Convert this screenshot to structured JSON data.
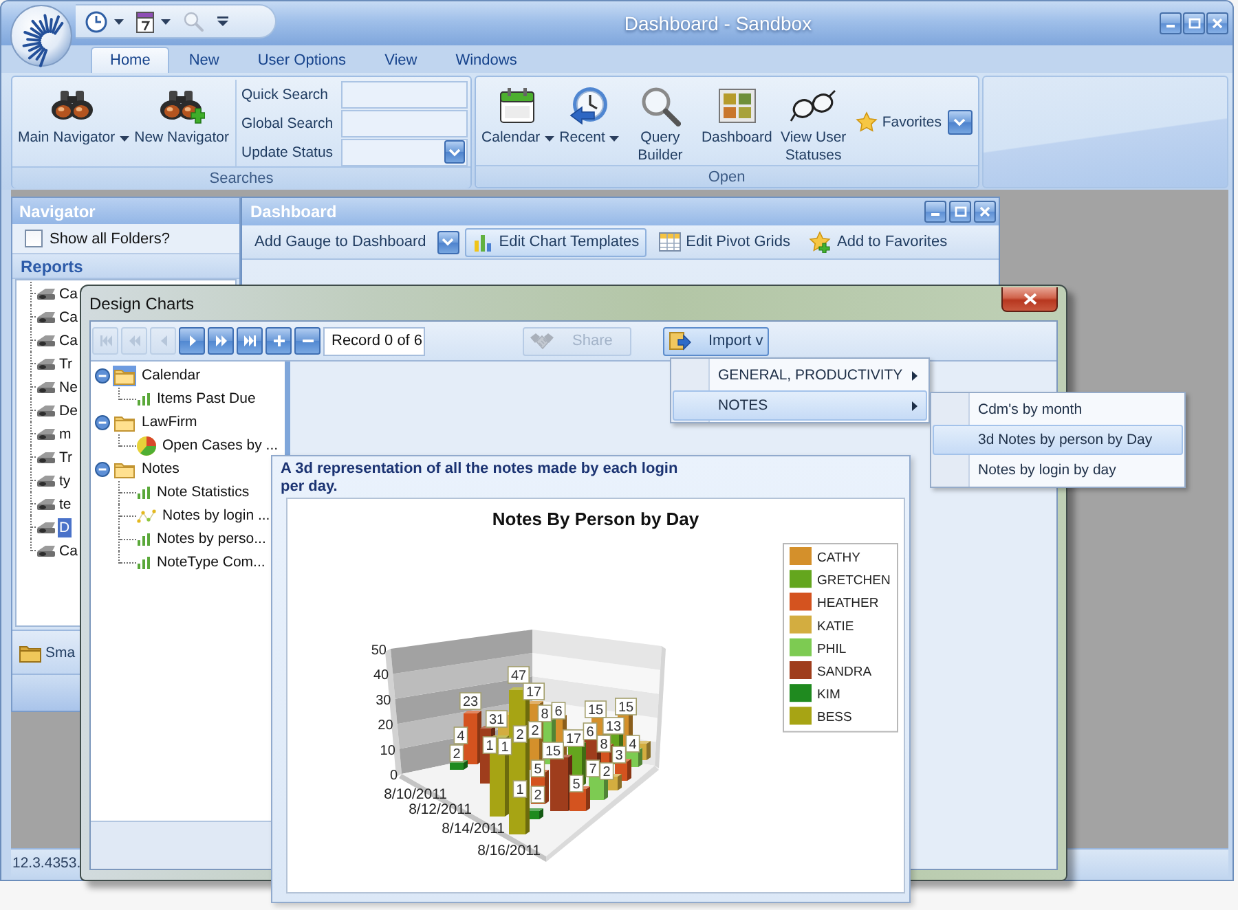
{
  "window": {
    "title": "Dashboard - Sandbox"
  },
  "ribbon_tabs": [
    {
      "label": "Home",
      "selected": true
    },
    {
      "label": "New",
      "selected": false
    },
    {
      "label": "User Options",
      "selected": false
    },
    {
      "label": "View",
      "selected": false
    },
    {
      "label": "Windows",
      "selected": false
    }
  ],
  "ribbon_groups": [
    {
      "title": "Searches",
      "buttons": [
        {
          "label": "Main Navigator",
          "kind": "binoculars",
          "dropdown": true
        },
        {
          "label": "New Navigator",
          "kind": "binoculars-plus",
          "dropdown": false
        }
      ],
      "fields": [
        {
          "label": "Quick Search",
          "kind": "text"
        },
        {
          "label": "Global Search",
          "kind": "text"
        },
        {
          "label": "Update Status",
          "kind": "combo"
        }
      ]
    },
    {
      "title": "Open",
      "buttons": [
        {
          "label": "Calendar",
          "kind": "calendar",
          "dropdown": true
        },
        {
          "label": "Recent",
          "kind": "clock",
          "dropdown": true
        },
        {
          "label": "Query Builder",
          "kind": "magnifier",
          "dropdown": false
        },
        {
          "label": "Dashboard",
          "kind": "dashboard",
          "dropdown": false
        },
        {
          "label": "View User Statuses",
          "kind": "glasses",
          "dropdown": false
        },
        {
          "label": "Favorites",
          "kind": "favorites",
          "dropdown": true
        }
      ]
    }
  ],
  "navigator": {
    "title": "Navigator",
    "show_all_folders": {
      "label": "Show all Folders?",
      "checked": false
    },
    "section": "Reports",
    "items": [
      {
        "label": "Ca",
        "selected": false
      },
      {
        "label": "Ca",
        "selected": false
      },
      {
        "label": "Ca",
        "selected": false
      },
      {
        "label": "Tr",
        "selected": false
      },
      {
        "label": "Ne",
        "selected": false
      },
      {
        "label": "De",
        "selected": false
      },
      {
        "label": "m",
        "selected": false
      },
      {
        "label": "Tr",
        "selected": false
      },
      {
        "label": "ty",
        "selected": false
      },
      {
        "label": "te",
        "selected": false
      },
      {
        "label": "D",
        "selected": true
      },
      {
        "label": "Ca",
        "selected": false
      }
    ],
    "bottom_button": "Sma"
  },
  "dashboard_window": {
    "title": "Dashboard",
    "toolbar": [
      {
        "label": "Add Gauge to Dashboard",
        "kind": "dropdown",
        "selected": false
      },
      {
        "label": "Edit Chart Templates",
        "kind": "chart",
        "selected": true
      },
      {
        "label": "Edit Pivot Grids",
        "kind": "grid",
        "selected": false
      },
      {
        "label": "Add to Favorites",
        "kind": "favorite",
        "selected": false
      }
    ]
  },
  "design_charts": {
    "title": "Design Charts",
    "record_buttons": [
      {
        "kind": "first",
        "disabled": true
      },
      {
        "kind": "previous-page",
        "disabled": true
      },
      {
        "kind": "previous",
        "disabled": true
      },
      {
        "kind": "next",
        "disabled": false
      },
      {
        "kind": "next-page",
        "disabled": false
      },
      {
        "kind": "last",
        "disabled": false
      },
      {
        "kind": "add",
        "disabled": false
      },
      {
        "kind": "remove",
        "disabled": false
      }
    ],
    "record": "Record 0 of 6",
    "share": {
      "label": "Share",
      "disabled": true
    },
    "import": {
      "label": "Import v",
      "pressed": true
    },
    "tree": [
      {
        "label": "Calendar",
        "expanded": true,
        "selected": true,
        "children": [
          {
            "label": "Items Past Due",
            "kind": "bar",
            "selected": false
          }
        ]
      },
      {
        "label": "LawFirm",
        "expanded": true,
        "selected": false,
        "children": [
          {
            "label": "Open Cases by ...",
            "kind": "pie",
            "selected": false
          }
        ]
      },
      {
        "label": "Notes",
        "expanded": true,
        "selected": false,
        "children": [
          {
            "label": "Note Statistics",
            "kind": "bar",
            "selected": false
          },
          {
            "label": "Notes by login ...",
            "kind": "scatter",
            "selected": false
          },
          {
            "label": "Notes by perso...",
            "kind": "bar",
            "selected": false
          },
          {
            "label": "NoteType Com...",
            "kind": "bar",
            "selected": false
          }
        ]
      }
    ],
    "import_menu": [
      {
        "label": "GENERAL, PRODUCTIVITY",
        "has_submenu": true,
        "selected": false
      },
      {
        "label": "NOTES",
        "has_submenu": true,
        "selected": true
      }
    ],
    "import_submenu": [
      {
        "label": "Cdm's by month",
        "selected": false
      },
      {
        "label": "3d Notes by person by Day",
        "selected": true
      },
      {
        "label": "Notes by login by day",
        "selected": false
      }
    ],
    "preview": {
      "description": "A 3d representation of all the notes made by each login per day.",
      "chart": {
        "title": "Notes By Person by Day",
        "legend": [
          {
            "name": "CATHY",
            "color": "#d4902b"
          },
          {
            "name": "GRETCHEN",
            "color": "#64a61e"
          },
          {
            "name": "HEATHER",
            "color": "#d4531f"
          },
          {
            "name": "KATIE",
            "color": "#d3ad40"
          },
          {
            "name": "PHIL",
            "color": "#7dcb52"
          },
          {
            "name": "SANDRA",
            "color": "#9f3d1c"
          },
          {
            "name": "KIM",
            "color": "#1f8a1f"
          },
          {
            "name": "BESS",
            "color": "#a7a414"
          }
        ],
        "y_axis_labels": [
          "50",
          "40",
          "30",
          "20",
          "10",
          "0"
        ],
        "date_labels": [
          "8/10/2011",
          "8/12/2011",
          "8/14/2011",
          "8/16/2011"
        ],
        "value_labels": [
          "47",
          "17",
          "23",
          "31",
          "8",
          "6",
          "15",
          "15",
          "4",
          "2",
          "2",
          "13",
          "1",
          "1",
          "17",
          "6",
          "8",
          "4",
          "2",
          "15",
          "3",
          "5",
          "7",
          "2",
          "5",
          "1",
          "2"
        ]
      }
    }
  },
  "status_bar": {
    "text": "12.3.4353."
  }
}
